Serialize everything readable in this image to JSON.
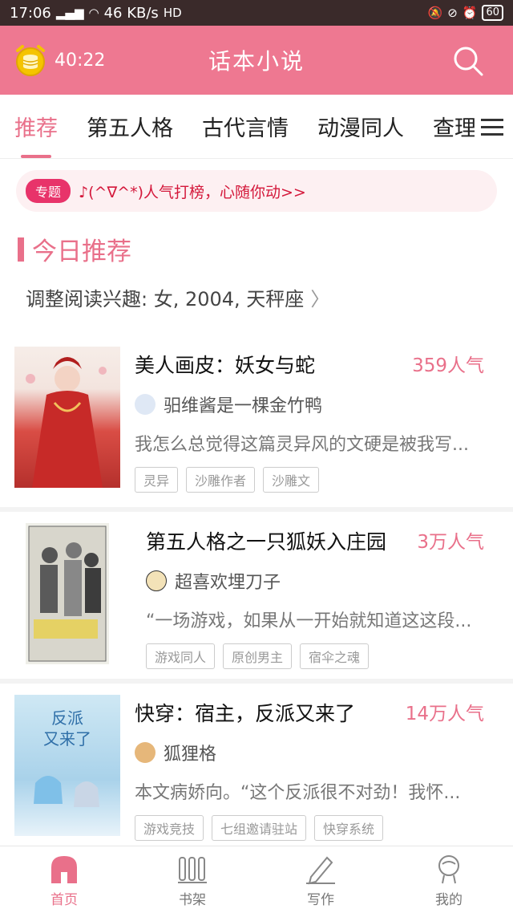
{
  "status": {
    "time": "17:06",
    "network": "46 KB/s",
    "battery": "60"
  },
  "appbar": {
    "timer": "40:22",
    "title": "话本小说"
  },
  "tabs": [
    {
      "label": "推荐",
      "active": true
    },
    {
      "label": "第五人格"
    },
    {
      "label": "古代言情"
    },
    {
      "label": "动漫同人"
    },
    {
      "label": "查理"
    }
  ],
  "topic": {
    "badge": "专题",
    "text": "♪(^∇^*)人气打榜，心随你动>>"
  },
  "section": {
    "title": "今日推荐",
    "interest": "调整阅读兴趣: 女, 2004, 天秤座",
    "interest_arrow": "〉"
  },
  "books": [
    {
      "title": "美人画皮：妖女与蛇",
      "popularity": "359人气",
      "author": "驲维酱是一棵金竹鸭",
      "desc": "我怎么总觉得这篇灵异风的文硬是被我写...",
      "tags": [
        "灵异",
        "沙雕作者",
        "沙雕文"
      ],
      "cover_color": "#c9403a"
    },
    {
      "title": "第五人格之一只狐妖入庄园",
      "popularity": "3万人气",
      "author": "超喜欢埋刀子",
      "desc": "“一场游戏，如果从一开始就知道这这段...",
      "tags": [
        "游戏同人",
        "原创男主",
        "宿伞之魂"
      ],
      "cover_color": "#8a8a7a"
    },
    {
      "title": "快穿：宿主，反派又来了",
      "popularity": "14万人气",
      "author": "狐狸格",
      "desc": "本文病娇向。“这个反派很不对劲！我怀...",
      "tags": [
        "游戏竞技",
        "七组邀请驻站",
        "快穿系统"
      ],
      "cover_color": "#9cc8e0"
    }
  ],
  "nav": [
    {
      "label": "首页",
      "active": true
    },
    {
      "label": "书架"
    },
    {
      "label": "写作"
    },
    {
      "label": "我的"
    }
  ]
}
